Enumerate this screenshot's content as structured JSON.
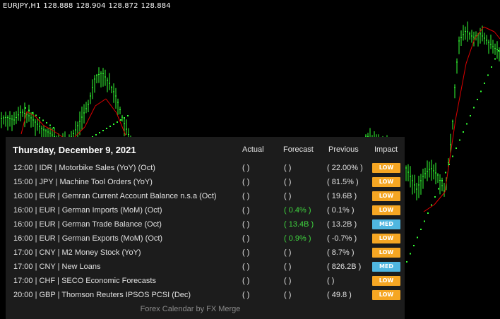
{
  "chart": {
    "symbol": "EURJPY,H1",
    "open": "128.888",
    "high": "128.904",
    "low": "128.872",
    "close": "128.884",
    "candle_color": "#33ff33",
    "ma_color": "#e00000",
    "sar_color": "#33ff33"
  },
  "calendar": {
    "title": "Thursday, December 9, 2021",
    "headers": {
      "actual": "Actual",
      "forecast": "Forecast",
      "previous": "Previous",
      "impact": "Impact"
    },
    "colors": {
      "low": "#f5a623",
      "med": "#4fb6e0",
      "forecast_text": "#3fd63f"
    },
    "rows": [
      {
        "event": "12:00  |  IDR  |  Motorbike Sales (YoY) (Oct)",
        "actual": "(   )",
        "forecast": "(   )",
        "forecast_colored": false,
        "previous": "( 22.00% )",
        "impact": "LOW",
        "level": "low"
      },
      {
        "event": "15:00  |  JPY  |  Machine Tool Orders (YoY)",
        "actual": "(   )",
        "forecast": "(   )",
        "forecast_colored": false,
        "previous": "( 81.5% )",
        "impact": "LOW",
        "level": "low"
      },
      {
        "event": "16:00  |  EUR  |  Gemran Current Account Balance n.s.a (Oct)",
        "actual": "(   )",
        "forecast": "(   )",
        "forecast_colored": false,
        "previous": "( 19.6B )",
        "impact": "LOW",
        "level": "low"
      },
      {
        "event": "16:00  |  EUR  |  German Imports (MoM) (Oct)",
        "actual": "(   )",
        "forecast": "( 0.4% )",
        "forecast_colored": true,
        "previous": "( 0.1% )",
        "impact": "LOW",
        "level": "low"
      },
      {
        "event": "16:00  |  EUR  |  German Trade Balance (Oct)",
        "actual": "(   )",
        "forecast": "( 13.4B )",
        "forecast_colored": true,
        "previous": "( 13.2B )",
        "impact": "MED",
        "level": "med"
      },
      {
        "event": "16:00  |  EUR  |  German Exports (MoM) (Oct)",
        "actual": "(   )",
        "forecast": "( 0.9% )",
        "forecast_colored": true,
        "previous": "( -0.7% )",
        "impact": "LOW",
        "level": "low"
      },
      {
        "event": "17:00  |  CNY  |  M2 Money Stock (YoY)",
        "actual": "(   )",
        "forecast": "(   )",
        "forecast_colored": false,
        "previous": "( 8.7% )",
        "impact": "LOW",
        "level": "low"
      },
      {
        "event": "17:00  |  CNY  |  New Loans",
        "actual": "(   )",
        "forecast": "(   )",
        "forecast_colored": false,
        "previous": "( 826.2B )",
        "impact": "MED",
        "level": "med"
      },
      {
        "event": "17:00  |  CHF  |  SECO Economic Forecasts",
        "actual": "(   )",
        "forecast": "(   )",
        "forecast_colored": false,
        "previous": "(   )",
        "impact": "LOW",
        "level": "low"
      },
      {
        "event": "20:00  |  GBP  |  Thomson Reuters IPSOS PCSI (Dec)",
        "actual": "(   )",
        "forecast": "(   )",
        "forecast_colored": false,
        "previous": "( 49.8 )",
        "impact": "LOW",
        "level": "low"
      }
    ],
    "footer": "Forex Calendar by FX Merge"
  }
}
